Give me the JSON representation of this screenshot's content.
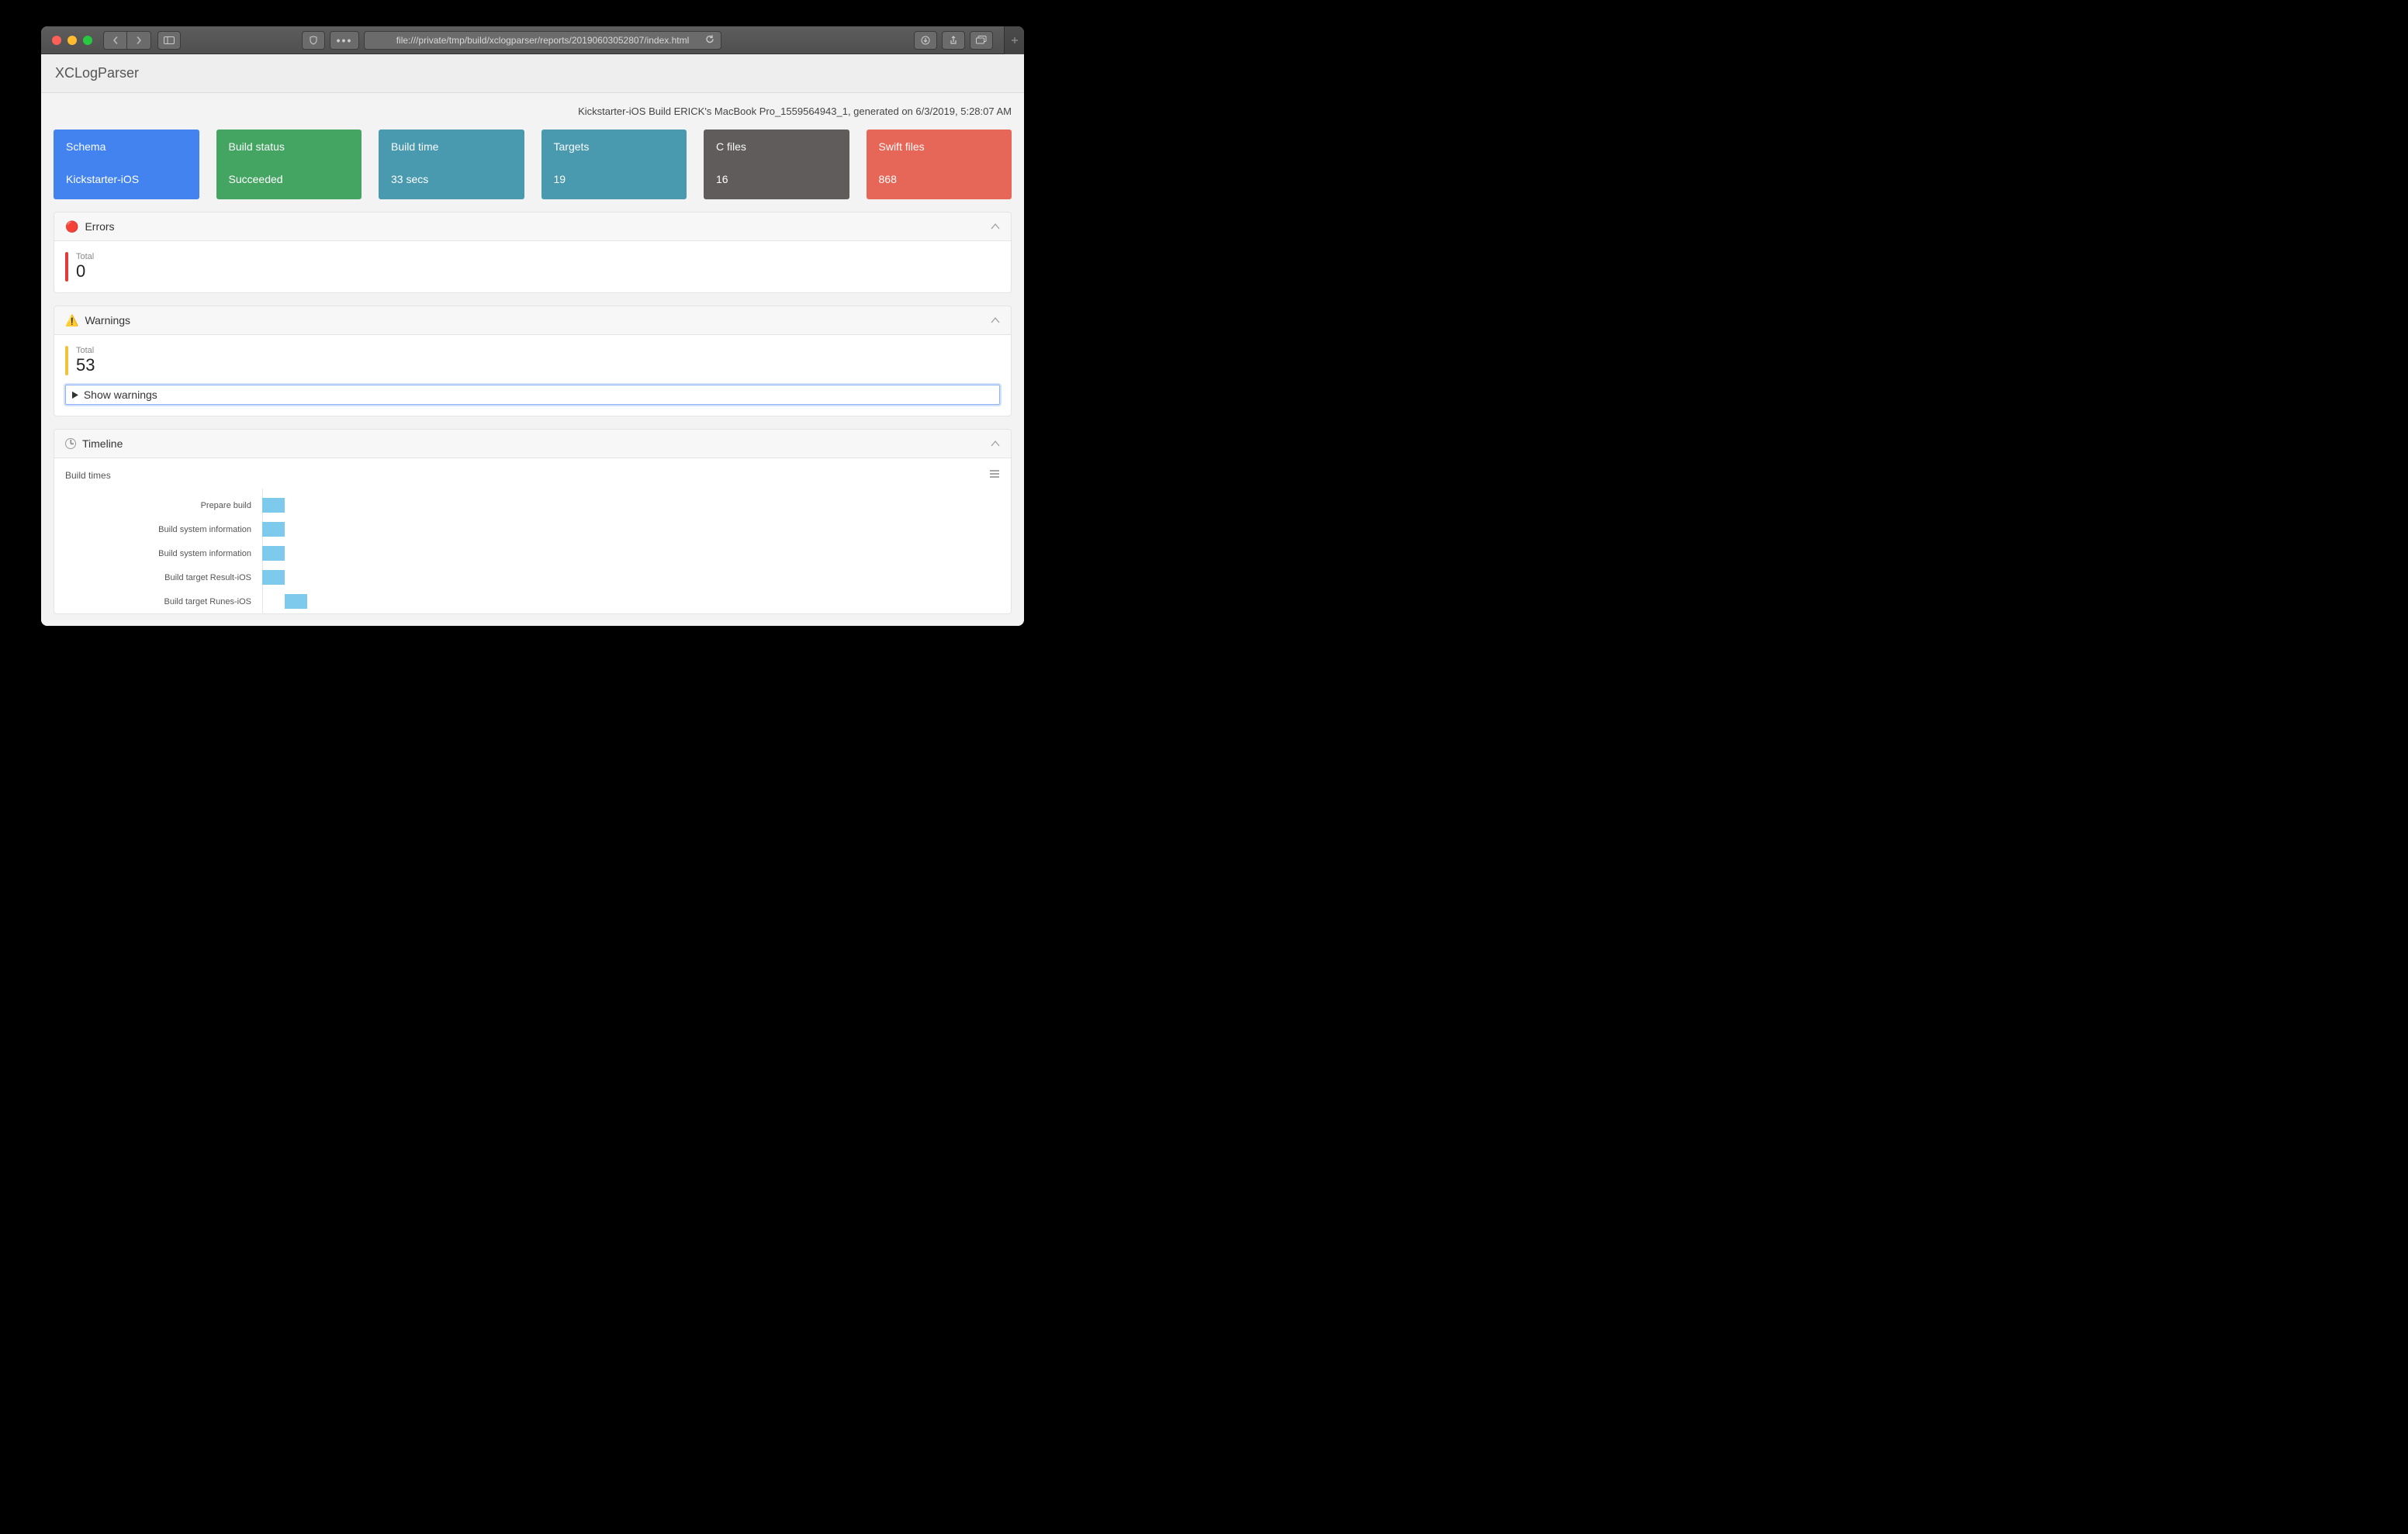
{
  "browser": {
    "url": "file:///private/tmp/build/xclogparser/reports/20190603052807/index.html"
  },
  "brand": "XCLogParser",
  "generated_line": "Kickstarter-iOS Build ERICK's MacBook Pro_1559564943_1, generated on 6/3/2019, 5:28:07 AM",
  "tiles": {
    "schema": {
      "label": "Schema",
      "value": "Kickstarter-iOS",
      "class": "blue"
    },
    "build_status": {
      "label": "Build status",
      "value": "Succeeded",
      "class": "green"
    },
    "build_time": {
      "label": "Build time",
      "value": "33 secs",
      "class": "teal"
    },
    "targets": {
      "label": "Targets",
      "value": "19",
      "class": "teal"
    },
    "c_files": {
      "label": "C files",
      "value": "16",
      "class": "dark"
    },
    "swift_files": {
      "label": "Swift files",
      "value": "868",
      "class": "red"
    }
  },
  "errors": {
    "title": "Errors",
    "total_label": "Total",
    "total_value": "0"
  },
  "warnings": {
    "title": "Warnings",
    "total_label": "Total",
    "total_value": "53",
    "show_label": "Show warnings"
  },
  "timeline": {
    "title": "Timeline",
    "chart_title": "Build times"
  },
  "chart_data": {
    "type": "bar",
    "orientation": "horizontal",
    "title": "Build times",
    "xlabel": "",
    "ylabel": "",
    "xlim_seconds": [
      0,
      33
    ],
    "note": "Bar start/length are in seconds along the build timeline; values are visual estimates.",
    "series": [
      {
        "name": "Prepare build",
        "start": 0.0,
        "length": 1.0
      },
      {
        "name": "Build system information",
        "start": 0.0,
        "length": 1.0
      },
      {
        "name": "Build system information",
        "start": 0.0,
        "length": 1.0
      },
      {
        "name": "Build target Result-iOS",
        "start": 0.0,
        "length": 1.0
      },
      {
        "name": "Build target Runes-iOS",
        "start": 1.0,
        "length": 1.0
      }
    ]
  }
}
